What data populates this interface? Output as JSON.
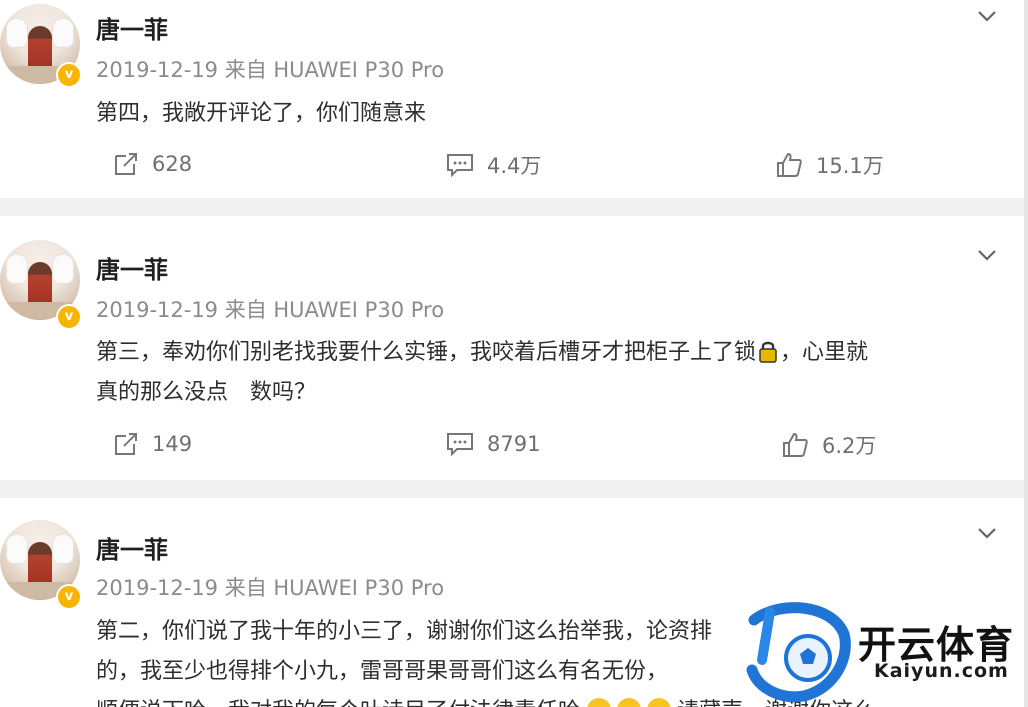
{
  "posts": [
    {
      "author": "唐一菲",
      "meta": "2019-12-19 来自 HUAWEI P30 Pro",
      "text_line1": "第四，我敞开评论了，你们随意来",
      "repost": "628",
      "comments": "4.4万",
      "likes": "15.1万"
    },
    {
      "author": "唐一菲",
      "meta": "2019-12-19 来自 HUAWEI P30 Pro",
      "text_line1a": "第三，奉劝你们别老找我要什么实锤，我咬着后槽牙才把柜子上了锁",
      "text_line1b": "，心里就",
      "text_line2": "真的那么没点　数吗？",
      "repost": "149",
      "comments": "8791",
      "likes": "6.2万"
    },
    {
      "author": "唐一菲",
      "meta": "2019-12-19 来自 HUAWEI P30 Pro",
      "text_line1": "第二，你们说了我十年的小三了，谢谢你们这么抬举我，论资排",
      "text_line2": "的，我至少也得排个小九，雷哥哥果哥哥们这么有名无份，",
      "text_line3": "顺便说下哈，我对我的每个叶诗目了付法律责任哈",
      "text_line3b": "请藏声，谢谢你这么"
    }
  ],
  "watermark": {
    "title": "开云体育",
    "subtitle": "Kaiyun.com"
  },
  "colors": {
    "badge": "#f7b500",
    "separator": "#f1f1f1",
    "meta": "#8b8b8b"
  },
  "icons": [
    "repost-icon",
    "comment-icon",
    "like-icon",
    "chevron-down-icon",
    "lock-icon"
  ]
}
